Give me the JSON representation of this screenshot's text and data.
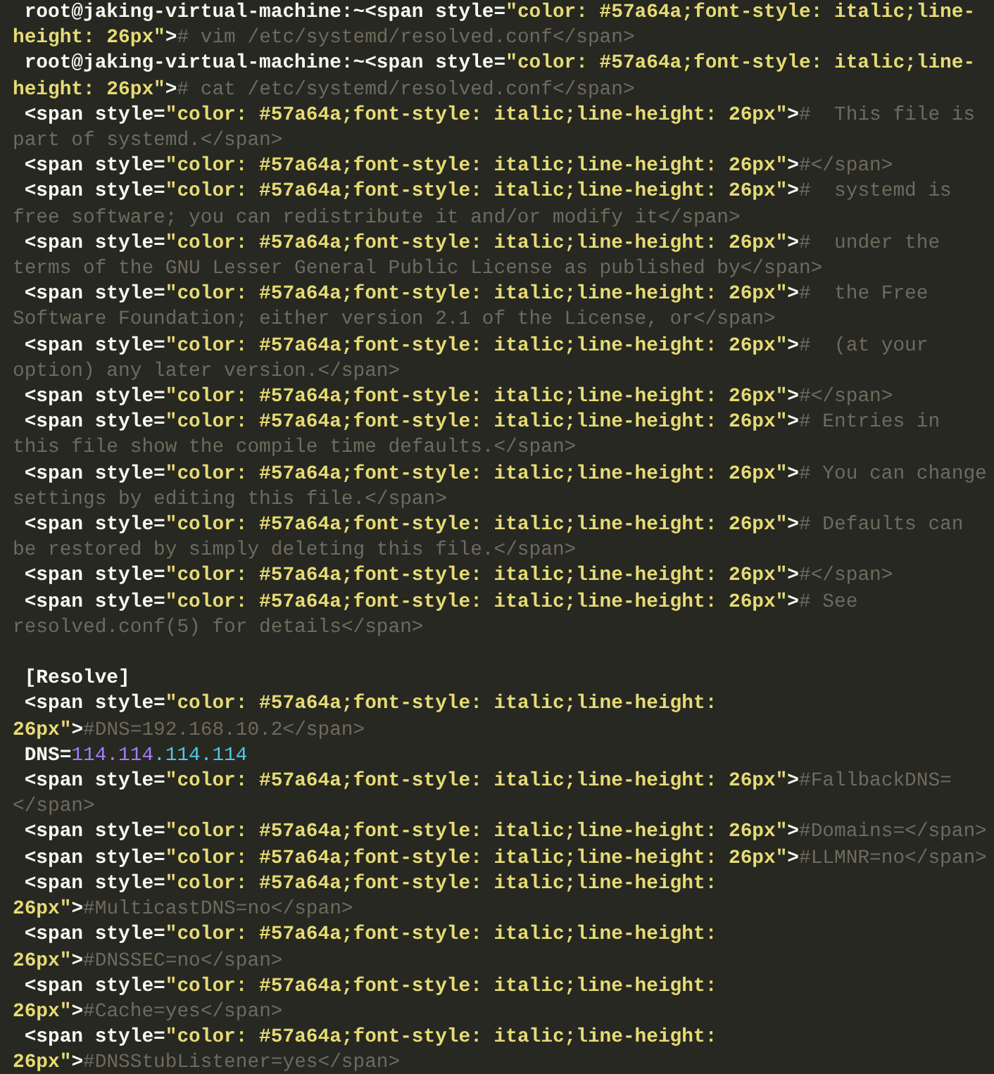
{
  "terminal": {
    "rows": [
      {
        "segments": [
          {
            "kind": "plain",
            "text": " root@jaking-virtual-machine:~<span style="
          },
          {
            "kind": "string",
            "text": "\"color: #57a64a;font-style: italic;line-"
          }
        ]
      },
      {
        "segments": [
          {
            "kind": "string",
            "text": "height: 26px\""
          },
          {
            "kind": "plain",
            "text": ">"
          },
          {
            "kind": "comment",
            "text": "# vim /etc/systemd/resolved.conf</span>"
          }
        ]
      },
      {
        "segments": [
          {
            "kind": "plain",
            "text": " root@jaking-virtual-machine:~<span style="
          },
          {
            "kind": "string",
            "text": "\"color: #57a64a;font-style: italic;line-"
          }
        ]
      },
      {
        "segments": [
          {
            "kind": "string",
            "text": "height: 26px\""
          },
          {
            "kind": "plain",
            "text": ">"
          },
          {
            "kind": "comment",
            "text": "# cat /etc/systemd/resolved.conf</span>"
          }
        ]
      },
      {
        "segments": [
          {
            "kind": "plain",
            "text": " <span style="
          },
          {
            "kind": "string",
            "text": "\"color: #57a64a;font-style: italic;line-height: 26px\""
          },
          {
            "kind": "plain",
            "text": ">"
          },
          {
            "kind": "comment",
            "text": "#  This file is"
          }
        ]
      },
      {
        "segments": [
          {
            "kind": "comment",
            "text": "part of systemd.</span>"
          }
        ]
      },
      {
        "segments": [
          {
            "kind": "plain",
            "text": " <span style="
          },
          {
            "kind": "string",
            "text": "\"color: #57a64a;font-style: italic;line-height: 26px\""
          },
          {
            "kind": "plain",
            "text": ">"
          },
          {
            "kind": "comment",
            "text": "#</span>"
          }
        ]
      },
      {
        "segments": [
          {
            "kind": "plain",
            "text": " <span style="
          },
          {
            "kind": "string",
            "text": "\"color: #57a64a;font-style: italic;line-height: 26px\""
          },
          {
            "kind": "plain",
            "text": ">"
          },
          {
            "kind": "comment",
            "text": "#  systemd is"
          }
        ]
      },
      {
        "segments": [
          {
            "kind": "comment",
            "text": "free software; you can redistribute it and/or modify it</span>"
          }
        ]
      },
      {
        "segments": [
          {
            "kind": "plain",
            "text": " <span style="
          },
          {
            "kind": "string",
            "text": "\"color: #57a64a;font-style: italic;line-height: 26px\""
          },
          {
            "kind": "plain",
            "text": ">"
          },
          {
            "kind": "comment",
            "text": "#  under the"
          }
        ]
      },
      {
        "segments": [
          {
            "kind": "comment",
            "text": "terms of the GNU Lesser General Public License as published by</span>"
          }
        ]
      },
      {
        "segments": [
          {
            "kind": "plain",
            "text": " <span style="
          },
          {
            "kind": "string",
            "text": "\"color: #57a64a;font-style: italic;line-height: 26px\""
          },
          {
            "kind": "plain",
            "text": ">"
          },
          {
            "kind": "comment",
            "text": "#  the Free"
          }
        ]
      },
      {
        "segments": [
          {
            "kind": "comment",
            "text": "Software Foundation; either version 2.1 of the License, or</span>"
          }
        ]
      },
      {
        "segments": [
          {
            "kind": "plain",
            "text": " <span style="
          },
          {
            "kind": "string",
            "text": "\"color: #57a64a;font-style: italic;line-height: 26px\""
          },
          {
            "kind": "plain",
            "text": ">"
          },
          {
            "kind": "comment",
            "text": "#  (at your"
          }
        ]
      },
      {
        "segments": [
          {
            "kind": "comment",
            "text": "option) any later version.</span>"
          }
        ]
      },
      {
        "segments": [
          {
            "kind": "plain",
            "text": " <span style="
          },
          {
            "kind": "string",
            "text": "\"color: #57a64a;font-style: italic;line-height: 26px\""
          },
          {
            "kind": "plain",
            "text": ">"
          },
          {
            "kind": "comment",
            "text": "#</span>"
          }
        ]
      },
      {
        "segments": [
          {
            "kind": "plain",
            "text": " <span style="
          },
          {
            "kind": "string",
            "text": "\"color: #57a64a;font-style: italic;line-height: 26px\""
          },
          {
            "kind": "plain",
            "text": ">"
          },
          {
            "kind": "comment",
            "text": "# Entries in"
          }
        ]
      },
      {
        "segments": [
          {
            "kind": "comment",
            "text": "this file show the compile time defaults.</span>"
          }
        ]
      },
      {
        "segments": [
          {
            "kind": "plain",
            "text": " <span style="
          },
          {
            "kind": "string",
            "text": "\"color: #57a64a;font-style: italic;line-height: 26px\""
          },
          {
            "kind": "plain",
            "text": ">"
          },
          {
            "kind": "comment",
            "text": "# You can change"
          }
        ]
      },
      {
        "segments": [
          {
            "kind": "comment",
            "text": "settings by editing this file.</span>"
          }
        ]
      },
      {
        "segments": [
          {
            "kind": "plain",
            "text": " <span style="
          },
          {
            "kind": "string",
            "text": "\"color: #57a64a;font-style: italic;line-height: 26px\""
          },
          {
            "kind": "plain",
            "text": ">"
          },
          {
            "kind": "comment",
            "text": "# Defaults can"
          }
        ]
      },
      {
        "segments": [
          {
            "kind": "comment",
            "text": "be restored by simply deleting this file.</span>"
          }
        ]
      },
      {
        "segments": [
          {
            "kind": "plain",
            "text": " <span style="
          },
          {
            "kind": "string",
            "text": "\"color: #57a64a;font-style: italic;line-height: 26px\""
          },
          {
            "kind": "plain",
            "text": ">"
          },
          {
            "kind": "comment",
            "text": "#</span>"
          }
        ]
      },
      {
        "segments": [
          {
            "kind": "plain",
            "text": " <span style="
          },
          {
            "kind": "string",
            "text": "\"color: #57a64a;font-style: italic;line-height: 26px\""
          },
          {
            "kind": "plain",
            "text": ">"
          },
          {
            "kind": "comment",
            "text": "# See"
          }
        ]
      },
      {
        "segments": [
          {
            "kind": "comment",
            "text": "resolved.conf(5) for details</span>"
          }
        ]
      },
      {
        "gap_before": true,
        "segments": [
          {
            "kind": "plain",
            "text": " [Resolve]"
          }
        ]
      },
      {
        "segments": [
          {
            "kind": "plain",
            "text": " <span style="
          },
          {
            "kind": "string",
            "text": "\"color: #57a64a;font-style: italic;line-height:"
          }
        ]
      },
      {
        "segments": [
          {
            "kind": "string",
            "text": "26px\""
          },
          {
            "kind": "plain",
            "text": ">"
          },
          {
            "kind": "comment",
            "text": "#DNS=192.168.10.2</span>"
          }
        ]
      },
      {
        "segments": [
          {
            "kind": "plain",
            "text": " DNS="
          },
          {
            "kind": "number",
            "text": "114.114"
          },
          {
            "kind": "number_alt",
            "text": ".114.114"
          }
        ]
      },
      {
        "segments": [
          {
            "kind": "plain",
            "text": " <span style="
          },
          {
            "kind": "string",
            "text": "\"color: #57a64a;font-style: italic;line-height: 26px\""
          },
          {
            "kind": "plain",
            "text": ">"
          },
          {
            "kind": "comment",
            "text": "#FallbackDNS="
          }
        ]
      },
      {
        "segments": [
          {
            "kind": "comment",
            "text": "</span>"
          }
        ]
      },
      {
        "segments": [
          {
            "kind": "plain",
            "text": " <span style="
          },
          {
            "kind": "string",
            "text": "\"color: #57a64a;font-style: italic;line-height: 26px\""
          },
          {
            "kind": "plain",
            "text": ">"
          },
          {
            "kind": "comment",
            "text": "#Domains=</span>"
          }
        ]
      },
      {
        "segments": [
          {
            "kind": "plain",
            "text": " <span style="
          },
          {
            "kind": "string",
            "text": "\"color: #57a64a;font-style: italic;line-height: 26px\""
          },
          {
            "kind": "plain",
            "text": ">"
          },
          {
            "kind": "comment",
            "text": "#LLMNR=no</span>"
          }
        ]
      },
      {
        "segments": [
          {
            "kind": "plain",
            "text": " <span style="
          },
          {
            "kind": "string",
            "text": "\"color: #57a64a;font-style: italic;line-height:"
          }
        ]
      },
      {
        "segments": [
          {
            "kind": "string",
            "text": "26px\""
          },
          {
            "kind": "plain",
            "text": ">"
          },
          {
            "kind": "comment",
            "text": "#MulticastDNS=no</span>"
          }
        ]
      },
      {
        "segments": [
          {
            "kind": "plain",
            "text": " <span style="
          },
          {
            "kind": "string",
            "text": "\"color: #57a64a;font-style: italic;line-height:"
          }
        ]
      },
      {
        "segments": [
          {
            "kind": "string",
            "text": "26px\""
          },
          {
            "kind": "plain",
            "text": ">"
          },
          {
            "kind": "comment",
            "text": "#DNSSEC=no</span>"
          }
        ]
      },
      {
        "segments": [
          {
            "kind": "plain",
            "text": " <span style="
          },
          {
            "kind": "string",
            "text": "\"color: #57a64a;font-style: italic;line-height:"
          }
        ]
      },
      {
        "segments": [
          {
            "kind": "string",
            "text": "26px\""
          },
          {
            "kind": "plain",
            "text": ">"
          },
          {
            "kind": "comment",
            "text": "#Cache=yes</span>"
          }
        ]
      },
      {
        "segments": [
          {
            "kind": "plain",
            "text": " <span style="
          },
          {
            "kind": "string",
            "text": "\"color: #57a64a;font-style: italic;line-height:"
          }
        ]
      },
      {
        "segments": [
          {
            "kind": "string",
            "text": "26px\""
          },
          {
            "kind": "plain",
            "text": ">"
          },
          {
            "kind": "comment",
            "text": "#DNSStubListener=yes</span>"
          }
        ]
      }
    ]
  }
}
